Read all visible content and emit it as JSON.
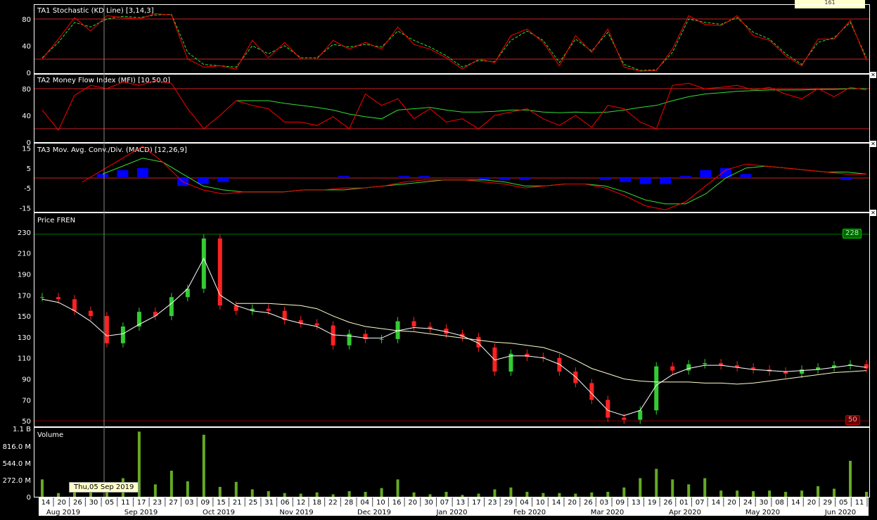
{
  "top_indicator_label": "161",
  "tooltip_date": "Thu,05 Sep 2019",
  "panels": {
    "stoch": {
      "title": "TA1 Stochastic (KD Line) [3,14,3]",
      "ticks": [
        "80",
        "40",
        "0"
      ]
    },
    "mfi": {
      "title": "TA2 Money Flow Index (MFI) [10,50,0]",
      "ticks": [
        "80",
        "40",
        "0"
      ]
    },
    "macd": {
      "title": "TA3 Mov. Avg. Conv./Div. (MACD) [12,26,9]",
      "ticks": [
        "15",
        "5",
        "-5",
        "-15"
      ]
    },
    "price": {
      "title": "Price FREN",
      "ticks": [
        "230",
        "210",
        "190",
        "170",
        "150",
        "130",
        "110",
        "90",
        "70",
        "50"
      ],
      "max_tag": "228",
      "min_tag": "50"
    },
    "volume": {
      "title": "Volume",
      "ticks": [
        "1.1 B",
        "816.0 M",
        "544.0 M",
        "272.0 M",
        "0"
      ]
    }
  },
  "x_axis": {
    "days": [
      "14",
      "20",
      "26",
      "30",
      "05",
      "11",
      "17",
      "23",
      "27",
      "03",
      "09",
      "15",
      "21",
      "25",
      "31",
      "06",
      "12",
      "18",
      "22",
      "28",
      "04",
      "10",
      "16",
      "20",
      "30",
      "07",
      "13",
      "17",
      "23",
      "29",
      "04",
      "10",
      "14",
      "20",
      "26",
      "03",
      "09",
      "13",
      "19",
      "26",
      "01",
      "07",
      "14",
      "20",
      "24",
      "30",
      "08",
      "14",
      "20",
      "29",
      "05",
      "11"
    ],
    "months": [
      "Aug 2019",
      "Sep 2019",
      "Oct 2019",
      "Nov 2019",
      "Dec 2019",
      "Jan 2020",
      "Feb 2020",
      "Mar 2020",
      "Apr 2020",
      "May 2020",
      "Jun 2020"
    ]
  },
  "chart_data": [
    {
      "type": "line",
      "title": "TA1 Stochastic (KD Line) [3,14,3]",
      "ylim": [
        0,
        100
      ],
      "reference_lines": [
        80,
        20
      ],
      "series": [
        {
          "name": "K",
          "color": "#ff0000",
          "values": [
            20,
            50,
            82,
            62,
            85,
            82,
            80,
            88,
            86,
            20,
            8,
            10,
            5,
            48,
            22,
            45,
            20,
            20,
            48,
            35,
            45,
            35,
            68,
            42,
            35,
            22,
            5,
            20,
            15,
            55,
            65,
            45,
            10,
            55,
            30,
            65,
            8,
            2,
            3,
            35,
            85,
            72,
            70,
            85,
            55,
            48,
            25,
            10,
            50,
            50,
            78,
            18
          ]
        },
        {
          "name": "D",
          "color": "#33dd33",
          "values": [
            22,
            45,
            75,
            68,
            80,
            84,
            82,
            86,
            87,
            30,
            12,
            10,
            8,
            40,
            28,
            40,
            22,
            22,
            42,
            38,
            42,
            38,
            62,
            48,
            38,
            25,
            8,
            18,
            16,
            48,
            62,
            48,
            15,
            50,
            32,
            60,
            12,
            3,
            4,
            30,
            80,
            75,
            72,
            82,
            60,
            50,
            28,
            12,
            45,
            52,
            75,
            22
          ]
        }
      ]
    },
    {
      "type": "line",
      "title": "TA2 Money Flow Index (MFI) [10,50,0]",
      "ylim": [
        0,
        100
      ],
      "reference_lines": [
        80,
        20
      ],
      "series": [
        {
          "name": "MFI",
          "color": "#ff0000",
          "values": [
            48,
            18,
            70,
            85,
            80,
            90,
            85,
            92,
            88,
            50,
            20,
            40,
            62,
            55,
            50,
            30,
            30,
            25,
            38,
            20,
            72,
            55,
            65,
            35,
            50,
            30,
            35,
            20,
            40,
            45,
            50,
            35,
            25,
            40,
            22,
            55,
            50,
            30,
            20,
            85,
            88,
            80,
            82,
            85,
            78,
            82,
            72,
            65,
            80,
            68,
            82,
            78
          ]
        },
        {
          "name": "Signal",
          "color": "#33dd33",
          "values": [
            null,
            null,
            null,
            null,
            null,
            null,
            null,
            null,
            null,
            null,
            null,
            null,
            62,
            62,
            62,
            58,
            55,
            52,
            48,
            42,
            38,
            35,
            48,
            50,
            52,
            48,
            45,
            45,
            46,
            48,
            48,
            45,
            44,
            45,
            44,
            45,
            48,
            52,
            55,
            62,
            68,
            72,
            74,
            76,
            77,
            78,
            78,
            78,
            79,
            79,
            80,
            80
          ]
        }
      ]
    },
    {
      "type": "line",
      "title": "TA3 Mov. Avg. Conv./Div. (MACD) [12,26,9]",
      "ylim": [
        -17,
        17
      ],
      "reference_lines": [
        0
      ],
      "series": [
        {
          "name": "MACD",
          "color": "#ff0000",
          "values": [
            null,
            null,
            -2,
            4,
            10,
            16,
            8,
            -2,
            -6,
            -8,
            -7,
            -7,
            -7,
            -6,
            -6,
            -5,
            -5,
            -4,
            -2,
            -1,
            -1,
            -1,
            -2,
            -3,
            -5,
            -4,
            -3,
            -3,
            -5,
            -9,
            -14,
            -16,
            -12,
            -4,
            4,
            7,
            6,
            5,
            4,
            3,
            2,
            2
          ]
        },
        {
          "name": "Signal",
          "color": "#33dd33",
          "values": [
            null,
            null,
            null,
            2,
            6,
            10,
            8,
            2,
            -4,
            -6,
            -7,
            -7,
            -7,
            -6,
            -6,
            -6,
            -5,
            -4,
            -3,
            -2,
            -1,
            -1,
            -1,
            -2,
            -4,
            -4,
            -3,
            -3,
            -4,
            -7,
            -11,
            -13,
            -13,
            -8,
            0,
            5,
            6,
            5,
            4,
            3,
            3,
            2
          ]
        },
        {
          "name": "Histogram",
          "color": "#0000ff",
          "values": [
            0,
            0,
            0,
            2,
            4,
            5,
            0,
            -4,
            -3,
            -2,
            0,
            0,
            0,
            0,
            0,
            1,
            0,
            0,
            1,
            1,
            0,
            0,
            -1,
            -1,
            -1,
            0,
            0,
            0,
            -1,
            -2,
            -3,
            -3,
            1,
            4,
            5,
            2,
            0,
            0,
            0,
            0,
            -1,
            0
          ]
        }
      ]
    },
    {
      "type": "candlestick",
      "title": "Price FREN",
      "ylim": [
        50,
        230
      ],
      "horizontal_lines": [
        228,
        50
      ],
      "close": [
        168,
        166,
        155,
        150,
        124,
        140,
        154,
        150,
        168,
        176,
        224,
        160,
        155,
        157,
        155,
        146,
        143,
        141,
        122,
        133,
        128,
        128,
        145,
        140,
        138,
        133,
        130,
        120,
        97,
        114,
        111,
        110,
        97,
        86,
        70,
        53,
        51,
        60,
        102,
        98,
        104,
        105,
        103,
        101,
        99,
        97,
        95,
        99,
        101,
        103,
        104,
        100
      ],
      "ma_short": [
        166,
        163,
        155,
        145,
        131,
        133,
        142,
        150,
        162,
        176,
        205,
        170,
        160,
        155,
        153,
        147,
        143,
        140,
        132,
        131,
        129,
        129,
        136,
        139,
        138,
        135,
        131,
        124,
        108,
        112,
        112,
        110,
        104,
        92,
        76,
        60,
        55,
        60,
        84,
        94,
        100,
        103,
        103,
        101,
        99,
        98,
        97,
        98,
        99,
        101,
        103,
        101
      ],
      "ma_long": [
        null,
        null,
        null,
        null,
        null,
        null,
        null,
        null,
        null,
        null,
        null,
        null,
        162,
        162,
        162,
        161,
        160,
        157,
        150,
        144,
        140,
        138,
        136,
        135,
        133,
        131,
        129,
        127,
        125,
        124,
        122,
        120,
        115,
        108,
        100,
        95,
        90,
        88,
        87,
        87,
        87,
        86,
        86,
        85,
        86,
        88,
        90,
        92,
        94,
        96,
        97,
        98
      ]
    },
    {
      "type": "bar",
      "title": "Volume",
      "ylim": [
        0,
        1100000000.0
      ],
      "values": [
        280,
        60,
        90,
        100,
        180,
        300,
        1050,
        200,
        420,
        250,
        1000,
        160,
        240,
        120,
        90,
        60,
        50,
        70,
        40,
        90,
        80,
        140,
        280,
        70,
        40,
        80,
        30,
        50,
        120,
        150,
        80,
        60,
        60,
        50,
        70,
        80,
        150,
        300,
        450,
        280,
        200,
        300,
        100,
        100,
        90,
        100,
        80,
        100,
        170,
        130,
        580,
        80
      ]
    }
  ]
}
